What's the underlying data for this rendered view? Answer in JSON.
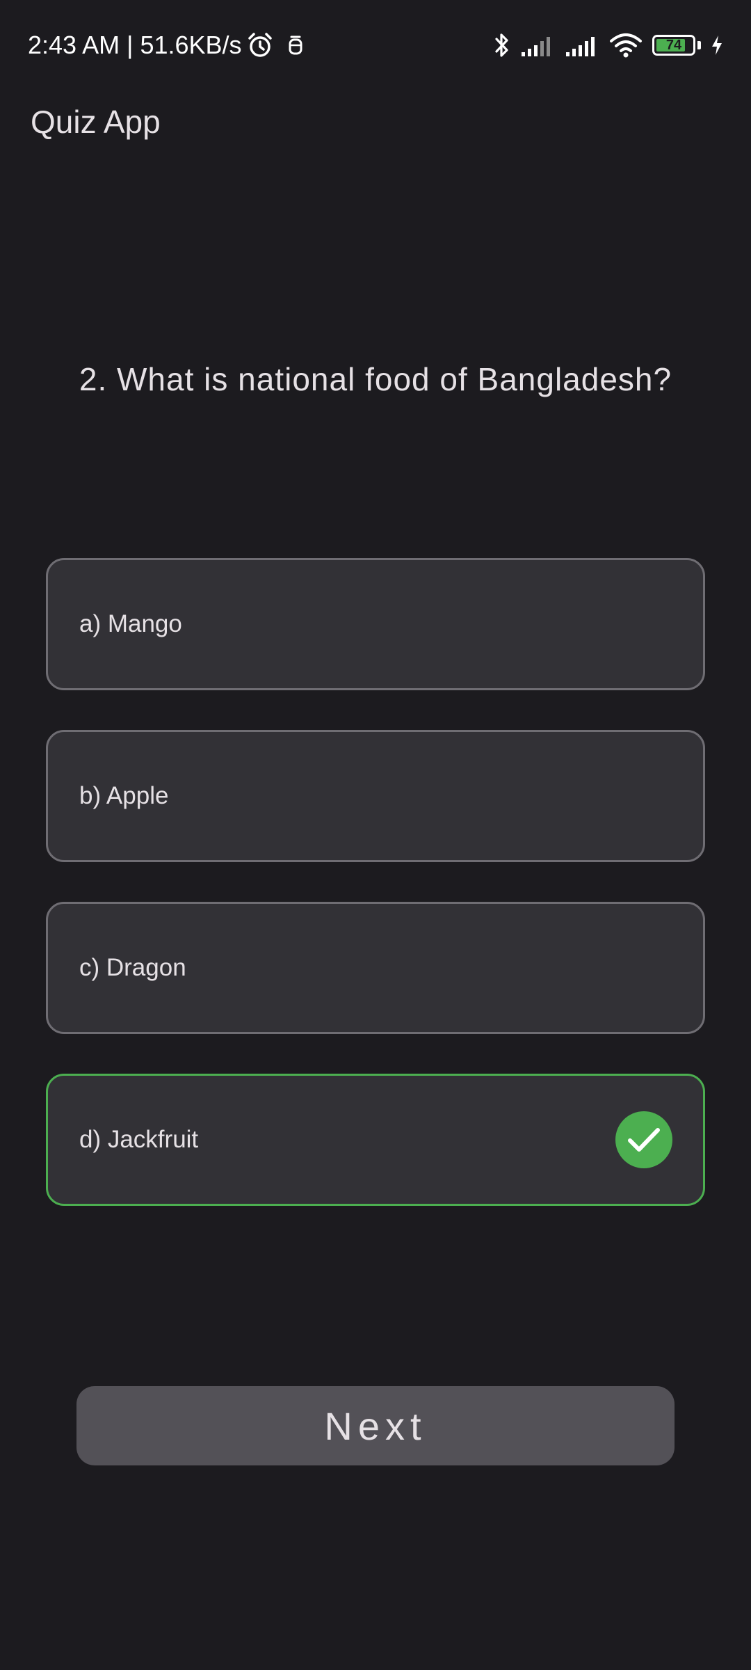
{
  "status_bar": {
    "time_speed": "2:43 AM | 51.6KB/s",
    "battery_level": "74",
    "battery_color": "#4caf50",
    "icons": [
      "alarm-icon",
      "notification-icon",
      "bluetooth-icon",
      "signal-icon",
      "signal-icon",
      "wifi-icon",
      "battery-icon",
      "charging-icon"
    ]
  },
  "app_bar": {
    "title": "Quiz App"
  },
  "question": {
    "text": "2. What is national food of Bangladesh?"
  },
  "options": [
    {
      "label": "a) Mango",
      "state": "default"
    },
    {
      "label": "b) Apple",
      "state": "default"
    },
    {
      "label": "c) Dragon",
      "state": "default"
    },
    {
      "label": "d) Jackfruit",
      "state": "correct",
      "icon": "check-circle-icon"
    }
  ],
  "colors": {
    "background": "#1c1b1f",
    "option_background": "#323136",
    "option_border": "#6f6d73",
    "correct_accent": "#4caf50",
    "button_background": "#535157",
    "text": "#e6e1e5"
  },
  "next_button": {
    "label": "Next"
  }
}
